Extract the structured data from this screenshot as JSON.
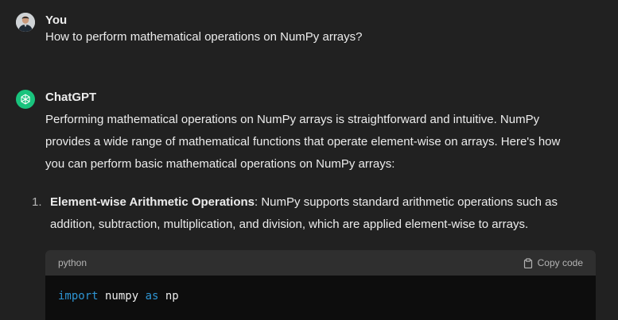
{
  "conversation": {
    "user": {
      "name": "You",
      "message": "How to perform mathematical operations on NumPy arrays?"
    },
    "assistant": {
      "name": "ChatGPT",
      "intro_lines": [
        "Performing mathematical operations on NumPy arrays is straightforward and intuitive. NumPy",
        "provides a wide range of mathematical functions that operate element-wise on arrays. Here's how",
        "you can perform basic mathematical operations on NumPy arrays:"
      ],
      "list": [
        {
          "number": "1.",
          "title": "Element-wise Arithmetic Operations",
          "text_line1": ": NumPy supports standard arithmetic operations such as",
          "text_line2": "addition, subtraction, multiplication, and division, which are applied element-wise to arrays."
        }
      ],
      "code_block": {
        "language": "python",
        "copy_label": "Copy code",
        "code": {
          "kw1": "import",
          "t1": " numpy ",
          "kw2": "as",
          "t2": " np"
        }
      }
    }
  },
  "icons": {
    "user_avatar": "user-avatar-photo",
    "assistant_avatar": "openai-logo-icon",
    "copy": "clipboard-icon"
  },
  "colors": {
    "background": "#212121",
    "assistant_avatar_bg": "#19c37d",
    "code_header_bg": "#2f2f2f",
    "code_bg": "#0d0d0d",
    "keyword": "#2e95d3"
  }
}
